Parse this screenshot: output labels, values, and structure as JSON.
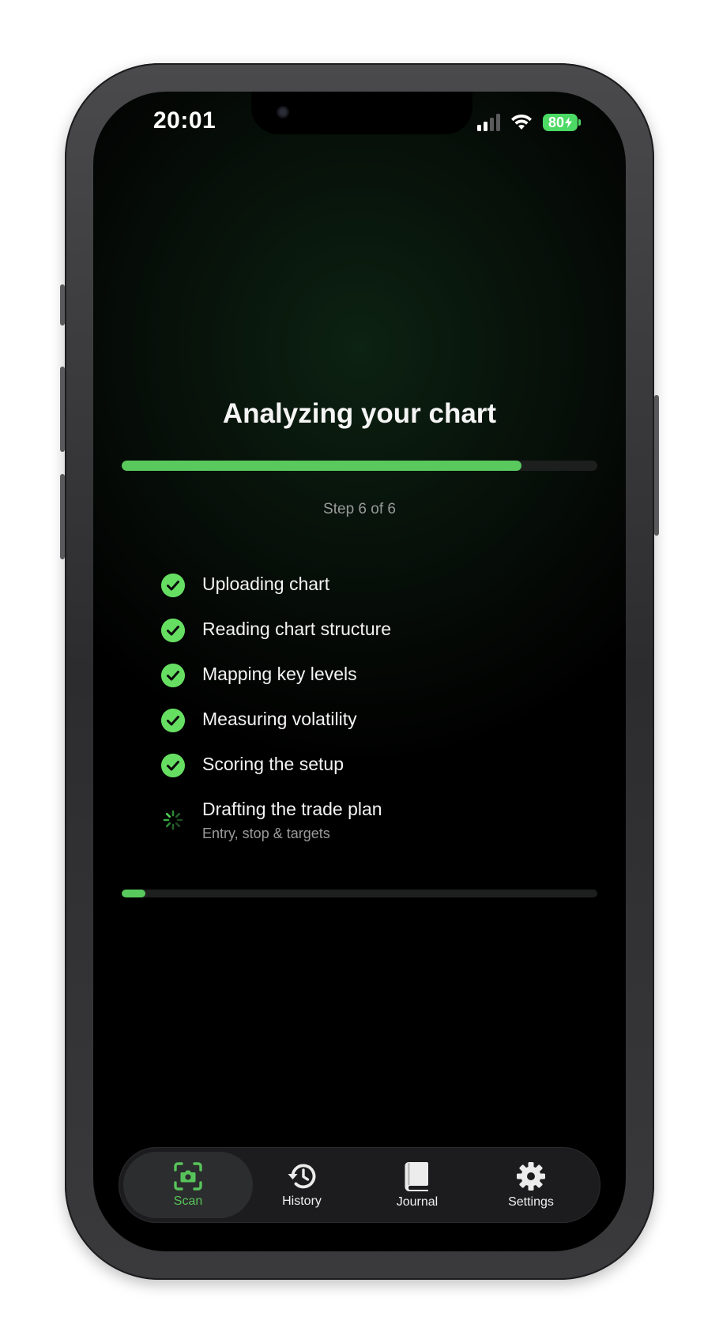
{
  "status_bar": {
    "time": "20:01",
    "battery": "80"
  },
  "analysis": {
    "title": "Analyzing your chart",
    "progress": 0.84,
    "step_text": "Step 6 of 6",
    "sub_progress": 0.05,
    "steps": [
      {
        "label": "Uploading chart",
        "state": "done"
      },
      {
        "label": "Reading chart structure",
        "state": "done"
      },
      {
        "label": "Mapping key levels",
        "state": "done"
      },
      {
        "label": "Measuring volatility",
        "state": "done"
      },
      {
        "label": "Scoring the setup",
        "state": "done"
      },
      {
        "label": "Drafting the trade plan",
        "detail": "Entry, stop & targets",
        "state": "in-progress"
      }
    ]
  },
  "tabbar": {
    "tabs": [
      {
        "label": "Scan",
        "icon": "scan-camera-icon",
        "active": true
      },
      {
        "label": "History",
        "icon": "history-icon",
        "active": false
      },
      {
        "label": "Journal",
        "icon": "journal-book-icon",
        "active": false
      },
      {
        "label": "Settings",
        "icon": "gear-icon",
        "active": false
      }
    ]
  },
  "colors": {
    "accent": "#59c95e",
    "check": "#66de62",
    "background": "#000000",
    "muted_text": "#9a9a9a"
  }
}
